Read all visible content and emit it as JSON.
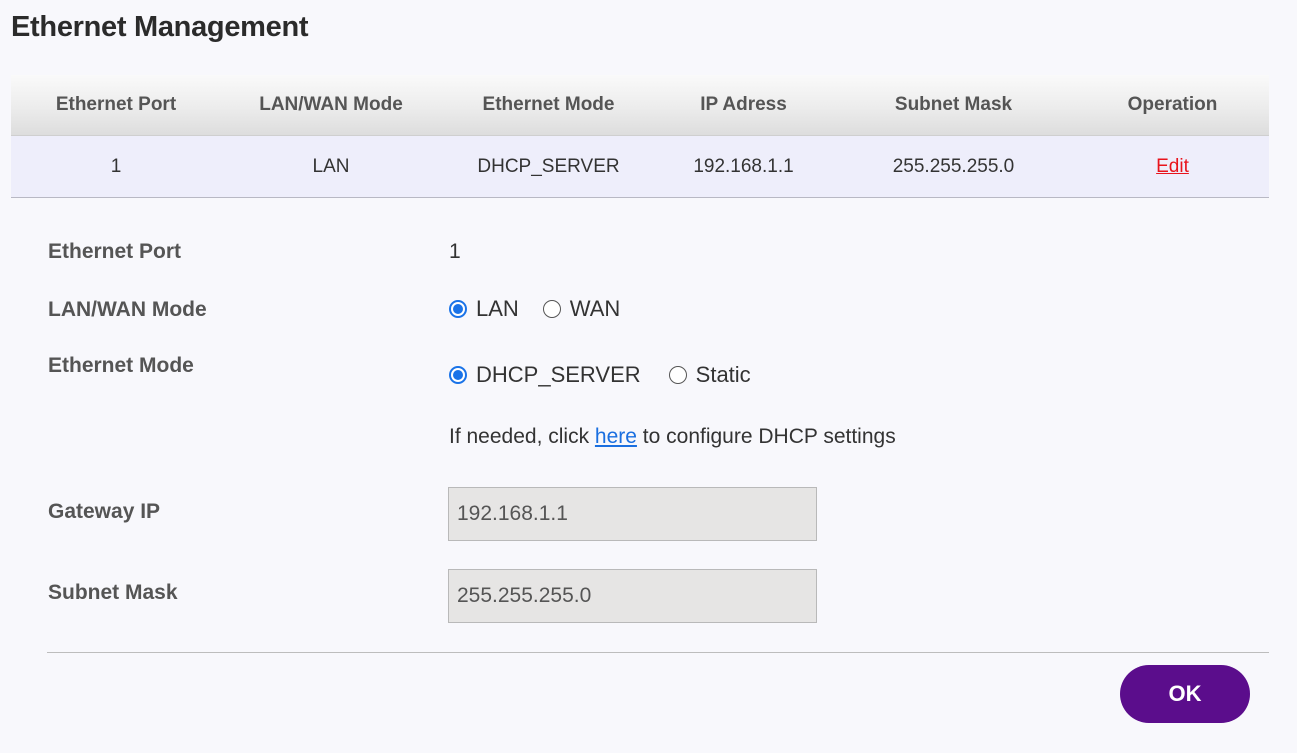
{
  "page_title": "Ethernet Management",
  "table": {
    "headers": [
      "Ethernet Port",
      "LAN/WAN Mode",
      "Ethernet Mode",
      "IP Adress",
      "Subnet Mask",
      "Operation"
    ],
    "rows": [
      {
        "port": "1",
        "lan_wan_mode": "LAN",
        "ethernet_mode": "DHCP_SERVER",
        "ip_address": "192.168.1.1",
        "subnet_mask": "255.255.255.0",
        "operation": "Edit"
      }
    ]
  },
  "form": {
    "ethernet_port": {
      "label": "Ethernet Port",
      "value": "1"
    },
    "lan_wan_mode": {
      "label": "LAN/WAN Mode",
      "options": [
        "LAN",
        "WAN"
      ],
      "selected": "LAN"
    },
    "ethernet_mode": {
      "label": "Ethernet Mode",
      "options": [
        "DHCP_SERVER",
        "Static"
      ],
      "selected": "DHCP_SERVER"
    },
    "dhcp_hint": {
      "prefix": "If needed, click ",
      "link": "here",
      "suffix": " to configure DHCP settings"
    },
    "gateway_ip": {
      "label": "Gateway IP",
      "value": "192.168.1.1"
    },
    "subnet_mask": {
      "label": "Subnet Mask",
      "value": "255.255.255.0"
    }
  },
  "actions": {
    "ok_label": "OK"
  },
  "colors": {
    "accent": "#5b0d8c",
    "link": "#1a6fe0",
    "edit_link": "#e8141c",
    "radio_selected": "#1a73e8",
    "row_highlight": "#eeeefb"
  },
  "icons": {
    "radio_selected": "radio-selected-icon",
    "radio_unselected": "radio-unselected-icon"
  }
}
